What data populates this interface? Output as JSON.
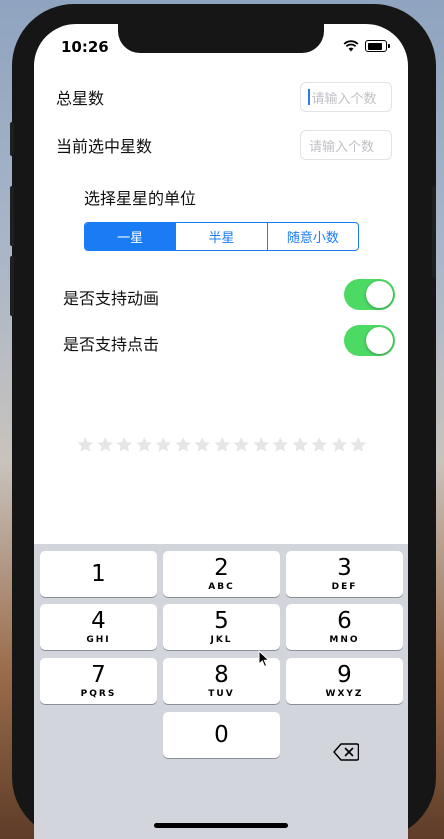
{
  "status_bar": {
    "time": "10:26"
  },
  "form": {
    "total_stars_label": "总星数",
    "total_stars_placeholder": "请输入个数",
    "current_stars_label": "当前选中星数",
    "current_stars_placeholder": "请输入个数",
    "unit_label": "选择星星的单位",
    "unit_options": [
      "一星",
      "半星",
      "随意小数"
    ],
    "unit_selected": "一星",
    "animation_label": "是否支持动画",
    "animation_enabled": true,
    "tap_label": "是否支持点击",
    "tap_enabled": true
  },
  "rating": {
    "star_count": 15,
    "selected": 0,
    "star_color": "#e6e6e6"
  },
  "keyboard": {
    "keys": [
      {
        "num": "1",
        "letters": ""
      },
      {
        "num": "2",
        "letters": "ABC"
      },
      {
        "num": "3",
        "letters": "DEF"
      },
      {
        "num": "4",
        "letters": "GHI"
      },
      {
        "num": "5",
        "letters": "JKL"
      },
      {
        "num": "6",
        "letters": "MNO"
      },
      {
        "num": "7",
        "letters": "PQRS"
      },
      {
        "num": "8",
        "letters": "TUV"
      },
      {
        "num": "9",
        "letters": "WXYZ"
      },
      {
        "num": "0",
        "letters": ""
      }
    ]
  },
  "colors": {
    "accent": "#1a7cf5",
    "toggle_on": "#4cd964",
    "keyboard_bg": "#d2d5db"
  }
}
